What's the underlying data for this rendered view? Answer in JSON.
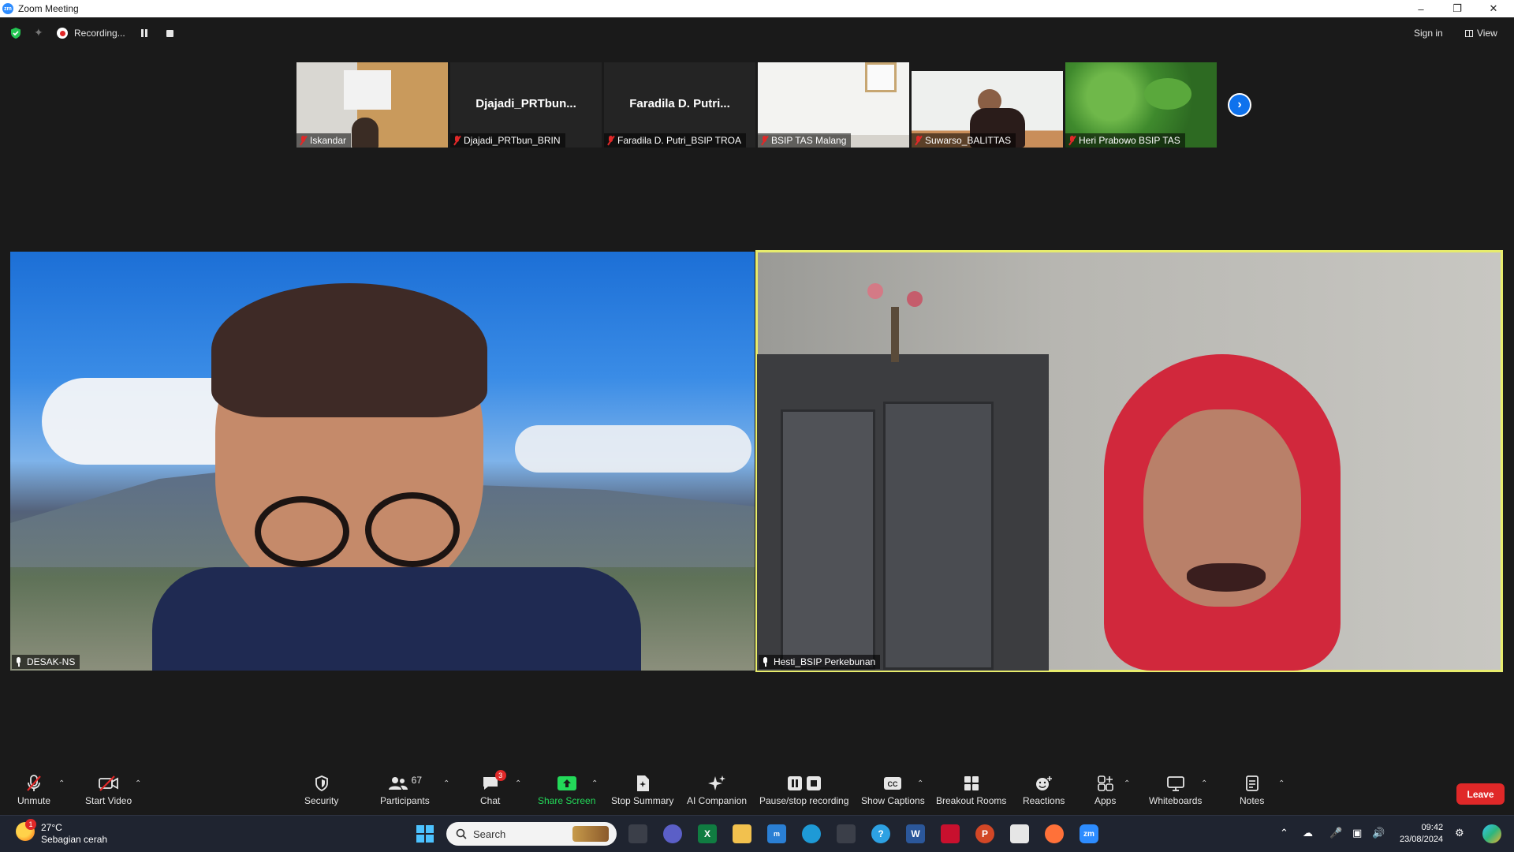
{
  "window": {
    "title": "Zoom Meeting",
    "app_logo": "zm",
    "controls": [
      "minimize-icon",
      "restore-icon",
      "close-icon"
    ]
  },
  "topbar": {
    "recording_label": "Recording...",
    "signin_label": "Sign in",
    "view_label": "View"
  },
  "thumbnails": [
    {
      "name": "Iskandar",
      "big_name": "",
      "muted": true
    },
    {
      "name": "Djajadi_PRTbun_BRIN",
      "big_name": "Djajadi_PRTbun...",
      "muted": true
    },
    {
      "name": "Faradila D. Putri_BSIP TROA",
      "big_name": "Faradila D. Putri...",
      "muted": true
    },
    {
      "name": "BSIP TAS Malang",
      "big_name": "",
      "muted": true
    },
    {
      "name": "Suwarso_BALITTAS",
      "big_name": "",
      "muted": true
    },
    {
      "name": "Heri Prabowo BSIP TAS",
      "big_name": "",
      "muted": true
    }
  ],
  "main_videos": [
    {
      "name": "DESAK-NS",
      "active_speaker": false
    },
    {
      "name": "Hesti_BSIP Perkebunan",
      "active_speaker": true
    }
  ],
  "toolbar": {
    "unmute": "Unmute",
    "start_video": "Start Video",
    "security": "Security",
    "participants": "Participants",
    "participants_count": "67",
    "chat": "Chat",
    "chat_badge": "3",
    "share_screen": "Share Screen",
    "stop_summary": "Stop Summary",
    "ai_companion": "AI Companion",
    "pause_recording": "Pause/stop recording",
    "show_captions": "Show Captions",
    "breakout_rooms": "Breakout Rooms",
    "reactions": "Reactions",
    "apps": "Apps",
    "whiteboards": "Whiteboards",
    "notes": "Notes",
    "leave": "Leave",
    "share_color": "#23d959",
    "leave_color": "#e02828"
  },
  "taskbar": {
    "weather_temp": "27°C",
    "weather_desc": "Sebagian cerah",
    "weather_badge": "1",
    "search_placeholder": "Search",
    "time": "09:42",
    "date": "23/08/2024"
  }
}
